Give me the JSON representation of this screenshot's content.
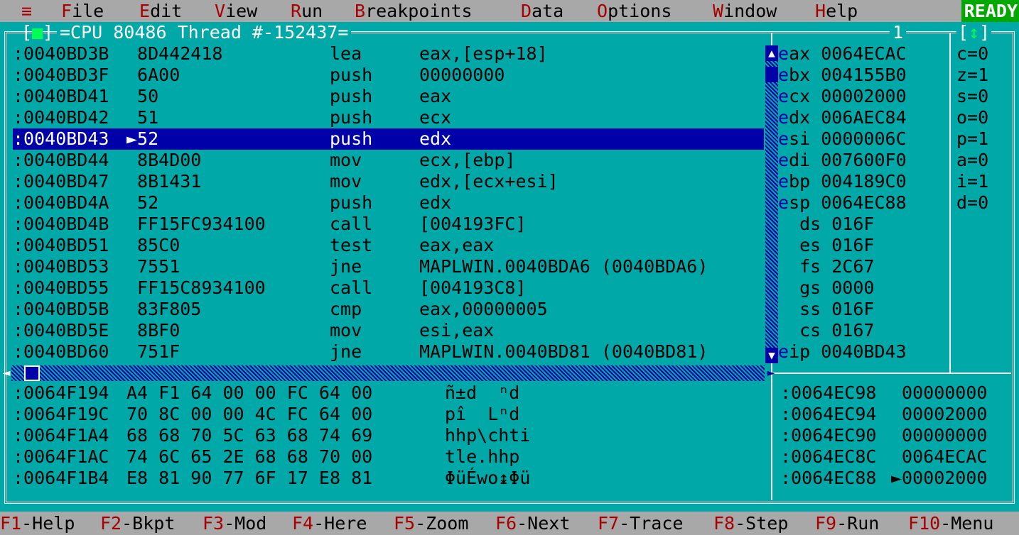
{
  "menu": {
    "system": "≡",
    "items": [
      {
        "hot": "F",
        "rest": "ile"
      },
      {
        "hot": "E",
        "rest": "dit"
      },
      {
        "hot": "V",
        "rest": "iew"
      },
      {
        "hot": "R",
        "rest": "un"
      },
      {
        "hot": "B",
        "rest": "reakpoints"
      },
      {
        "hot": "D",
        "rest": "ata"
      },
      {
        "hot": "O",
        "rest": "ptions"
      },
      {
        "hot": "W",
        "rest": "indow"
      },
      {
        "hot": "H",
        "rest": "elp"
      }
    ],
    "status": "READY"
  },
  "window": {
    "close_box": "[■]",
    "title": "=CPU 80486 Thread #-152437=",
    "number": "1",
    "zoom_box": "[↕]"
  },
  "code": [
    {
      "addr": ":0040BD3B",
      "bytes": " 8D442418",
      "op": "lea",
      "args": "eax,[esp+18]"
    },
    {
      "addr": ":0040BD3F",
      "bytes": " 6A00",
      "op": "push",
      "args": "00000000"
    },
    {
      "addr": ":0040BD41",
      "bytes": " 50",
      "op": "push",
      "args": "eax"
    },
    {
      "addr": ":0040BD42",
      "bytes": " 51",
      "op": "push",
      "args": "ecx"
    },
    {
      "addr": ":0040BD43",
      "bytes": "►52",
      "op": "push",
      "args": "edx"
    },
    {
      "addr": ":0040BD44",
      "bytes": " 8B4D00",
      "op": "mov",
      "args": "ecx,[ebp]"
    },
    {
      "addr": ":0040BD47",
      "bytes": " 8B1431",
      "op": "mov",
      "args": "edx,[ecx+esi]"
    },
    {
      "addr": ":0040BD4A",
      "bytes": " 52",
      "op": "push",
      "args": "edx"
    },
    {
      "addr": ":0040BD4B",
      "bytes": " FF15FC934100",
      "op": "call",
      "args": "[004193FC]"
    },
    {
      "addr": ":0040BD51",
      "bytes": " 85C0",
      "op": "test",
      "args": "eax,eax"
    },
    {
      "addr": ":0040BD53",
      "bytes": " 7551",
      "op": "jne",
      "args": "MAPLWIN.0040BDA6 (0040BDA6)"
    },
    {
      "addr": ":0040BD55",
      "bytes": " FF15C8934100",
      "op": "call",
      "args": "[004193C8]"
    },
    {
      "addr": ":0040BD5B",
      "bytes": " 83F805",
      "op": "cmp",
      "args": "eax,00000005"
    },
    {
      "addr": ":0040BD5E",
      "bytes": " 8BF0",
      "op": "mov",
      "args": "esi,eax"
    },
    {
      "addr": ":0040BD60",
      "bytes": " 751F",
      "op": "jne",
      "args": "MAPLWIN.0040BD81 (0040BD81)"
    }
  ],
  "selected_row": 4,
  "registers": [
    {
      "lead": "e",
      "rest": "ax 0064ECAC"
    },
    {
      "lead": "e",
      "rest": "bx 004155B0"
    },
    {
      "lead": "e",
      "rest": "cx 00002000"
    },
    {
      "lead": "e",
      "rest": "dx 006AEC84"
    },
    {
      "lead": "e",
      "rest": "si 0000006C"
    },
    {
      "lead": "e",
      "rest": "di 007600F0"
    },
    {
      "lead": "e",
      "rest": "bp 004189C0"
    },
    {
      "lead": "e",
      "rest": "sp 0064EC88"
    },
    {
      "lead": "",
      "rest": "  ds 016F"
    },
    {
      "lead": "",
      "rest": "  es 016F"
    },
    {
      "lead": "",
      "rest": "  fs 2C67"
    },
    {
      "lead": "",
      "rest": "  gs 0000"
    },
    {
      "lead": "",
      "rest": "  ss 016F"
    },
    {
      "lead": "",
      "rest": "  cs 0167"
    },
    {
      "lead": "e",
      "rest": "ip 0040BD43"
    }
  ],
  "flags": [
    "c=0",
    "z=1",
    "s=0",
    "o=0",
    "p=1",
    "a=0",
    "i=1",
    "d=0"
  ],
  "dump": [
    {
      "addr": ":0064F194",
      "bytes": "A4 F1 64 00 00 FC 64 00",
      "ascii": "ñ±d  ⁿd"
    },
    {
      "addr": ":0064F19C",
      "bytes": "70 8C 00 00 4C FC 64 00",
      "ascii": "pî  Lⁿd"
    },
    {
      "addr": ":0064F1A4",
      "bytes": "68 68 70 5C 63 68 74 69",
      "ascii": "hhp\\chti"
    },
    {
      "addr": ":0064F1AC",
      "bytes": "74 6C 65 2E 68 68 70 00",
      "ascii": "tle.hhp"
    },
    {
      "addr": ":0064F1B4",
      "bytes": "E8 81 90 77 6F 17 E8 81",
      "ascii": "ΦüÉwo↨Φü"
    }
  ],
  "stack": [
    {
      "addr": ":0064EC98",
      "val": " 00000000"
    },
    {
      "addr": ":0064EC94",
      "val": " 00002000"
    },
    {
      "addr": ":0064EC90",
      "val": " 00000000"
    },
    {
      "addr": ":0064EC8C",
      "val": " 0064ECAC"
    },
    {
      "addr": ":0064EC88",
      "val": "►00002000"
    }
  ],
  "fkeys": [
    {
      "key": "F1",
      "label": "-Help"
    },
    {
      "key": "F2",
      "label": "-Bkpt"
    },
    {
      "key": "F3",
      "label": "-Mod"
    },
    {
      "key": "F4",
      "label": "-Here"
    },
    {
      "key": "F5",
      "label": "-Zoom"
    },
    {
      "key": "F6",
      "label": "-Next"
    },
    {
      "key": "F7",
      "label": "-Trace"
    },
    {
      "key": "F8",
      "label": "-Step"
    },
    {
      "key": "F9",
      "label": "-Run"
    },
    {
      "key": "F10",
      "label": "-Menu"
    }
  ],
  "colors": {
    "background": "#00a8a8",
    "selection": "#0000a8",
    "hotkey": "#a80000",
    "ready": "#00a800",
    "bar": "#a8a8a8"
  }
}
